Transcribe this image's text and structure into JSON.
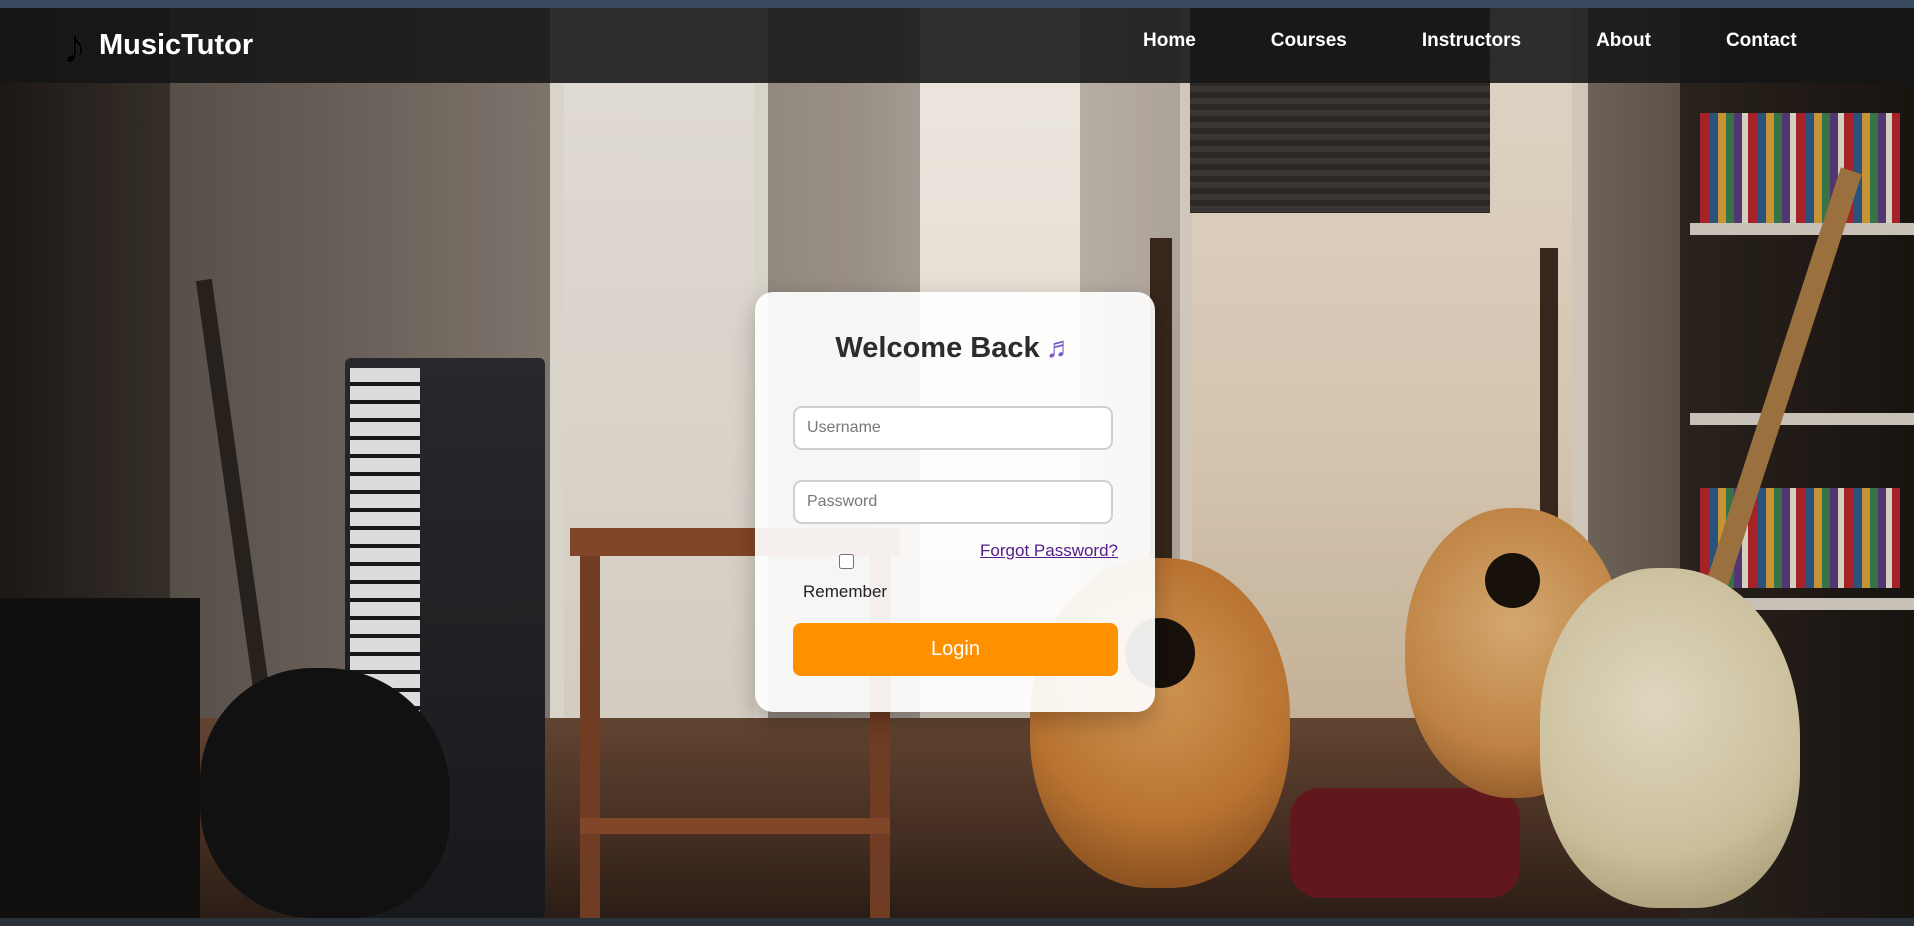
{
  "brand": {
    "icon": "♪",
    "icon_name": "music-note-icon",
    "name": "MusicTutor"
  },
  "nav": {
    "items": [
      "Home",
      "Courses",
      "Instructors",
      "About",
      "Contact"
    ]
  },
  "login": {
    "title": "Welcome Back",
    "title_emoji": "♬",
    "username_placeholder": "Username",
    "password_placeholder": "Password",
    "forgot_password": "Forgot Password?",
    "remember_label": "Remember",
    "remember_checked": false,
    "login_button": "Login"
  },
  "colors": {
    "accent": "#ff9100",
    "navbar_bg": "#161616",
    "link_visited": "#551a8b",
    "card_bg": "#ffffff"
  }
}
